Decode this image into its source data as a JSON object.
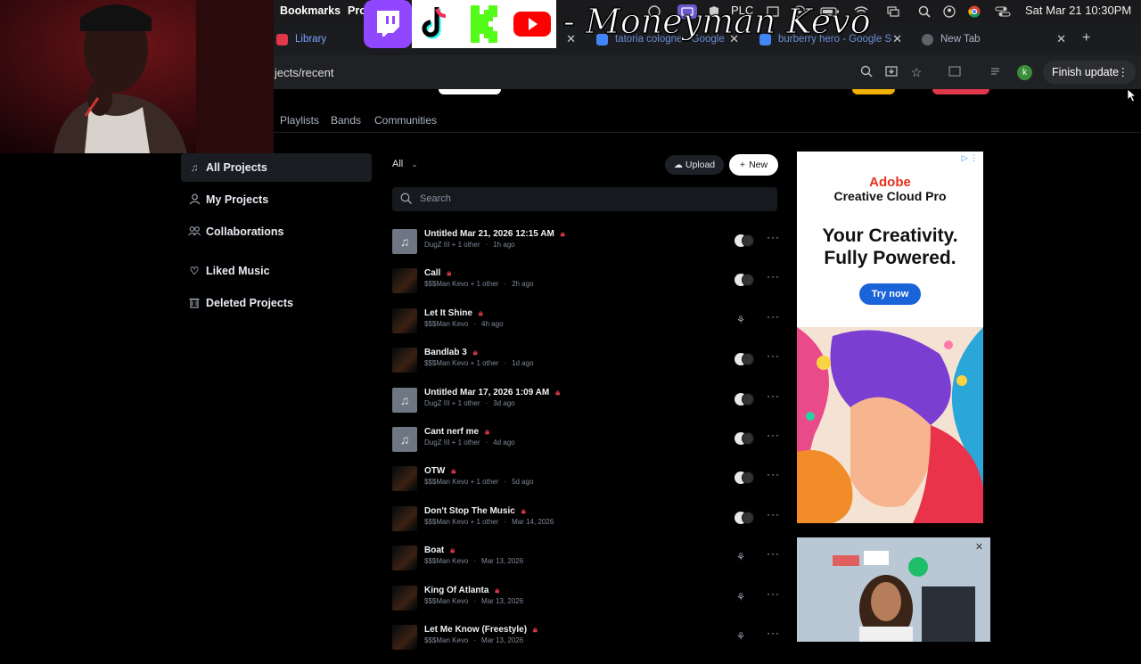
{
  "menubar": {
    "bookmarks": "Bookmarks",
    "profiles": "Pro",
    "plc": "PLC",
    "datetime": "Sat Mar 21  10:30PM"
  },
  "tabs": [
    {
      "label": "Library",
      "favicon_color": "#e0374a"
    },
    {
      "label": "tatoria cologne - Google",
      "favicon_color": "#4285f4"
    },
    {
      "label": "burberry hero - Google S",
      "favicon_color": "#4285f4"
    },
    {
      "label": "New Tab",
      "favicon_color": "#5f6368"
    }
  ],
  "new_tab_button": "+",
  "address_bar": {
    "url": "jects/recent",
    "finish_update": "Finish update",
    "profile_initial": "k"
  },
  "subnav": [
    "Playlists",
    "Bands",
    "Communities"
  ],
  "sidebar": {
    "items": [
      {
        "label": "All Projects",
        "icon": "music-note-icon"
      },
      {
        "label": "My Projects",
        "icon": "person-icon"
      },
      {
        "label": "Collaborations",
        "icon": "people-icon"
      },
      {
        "label": "Liked Music",
        "icon": "heart-icon"
      },
      {
        "label": "Deleted Projects",
        "icon": "trash-icon"
      }
    ]
  },
  "projects": {
    "filter": "All",
    "upload_label": "Upload",
    "new_label": "New",
    "search_placeholder": "Search",
    "rows": [
      {
        "title": "Untitled Mar 21, 2026 12:15 AM",
        "owner": "DugZ III + 1 other",
        "time": "1h ago",
        "thumb": "note",
        "collab": "pair"
      },
      {
        "title": "Call",
        "owner": "$$$Man Kevo + 1 other",
        "time": "2h ago",
        "thumb": "art",
        "collab": "pair"
      },
      {
        "title": "Let It Shine",
        "owner": "$$$Man Kevo",
        "time": "4h ago",
        "thumb": "art",
        "collab": "solo"
      },
      {
        "title": "Bandlab 3",
        "owner": "$$$Man Kevo + 1 other",
        "time": "1d ago",
        "thumb": "art",
        "collab": "pair"
      },
      {
        "title": "Untitled Mar 17, 2026 1:09 AM",
        "owner": "DugZ III + 1 other",
        "time": "3d ago",
        "thumb": "note",
        "collab": "pair"
      },
      {
        "title": "Cant nerf me",
        "owner": "DugZ III + 1 other",
        "time": "4d ago",
        "thumb": "note",
        "collab": "pair"
      },
      {
        "title": "OTW",
        "owner": "$$$Man Kevo + 1 other",
        "time": "5d ago",
        "thumb": "art",
        "collab": "pair"
      },
      {
        "title": "Don't Stop The Music",
        "owner": "$$$Man Kevo + 1 other",
        "time": "Mar 14, 2026",
        "thumb": "art",
        "collab": "pair"
      },
      {
        "title": "Boat",
        "owner": "$$$Man Kevo",
        "time": "Mar 13, 2026",
        "thumb": "art",
        "collab": "solo"
      },
      {
        "title": "King Of Atlanta",
        "owner": "$$$Man Kevo",
        "time": "Mar 13, 2026",
        "thumb": "art",
        "collab": "solo"
      },
      {
        "title": "Let Me Know (Freestyle)",
        "owner": "$$$Man Kevo",
        "time": "Mar 13, 2026",
        "thumb": "art",
        "collab": "solo"
      }
    ]
  },
  "ad": {
    "brand": "Adobe",
    "product": "Creative Cloud Pro",
    "headline_line1": "Your Creativity.",
    "headline_line2": "Fully Powered.",
    "cta": "Try now"
  },
  "overlay": {
    "streamer_name": "- Moneyman Kevo",
    "icons": [
      "twitch-icon",
      "tiktok-icon",
      "kick-icon",
      "youtube-icon"
    ]
  },
  "colors": {
    "accent_red": "#e0374a",
    "ad_blue": "#1a63d8",
    "bg": "#000000"
  }
}
